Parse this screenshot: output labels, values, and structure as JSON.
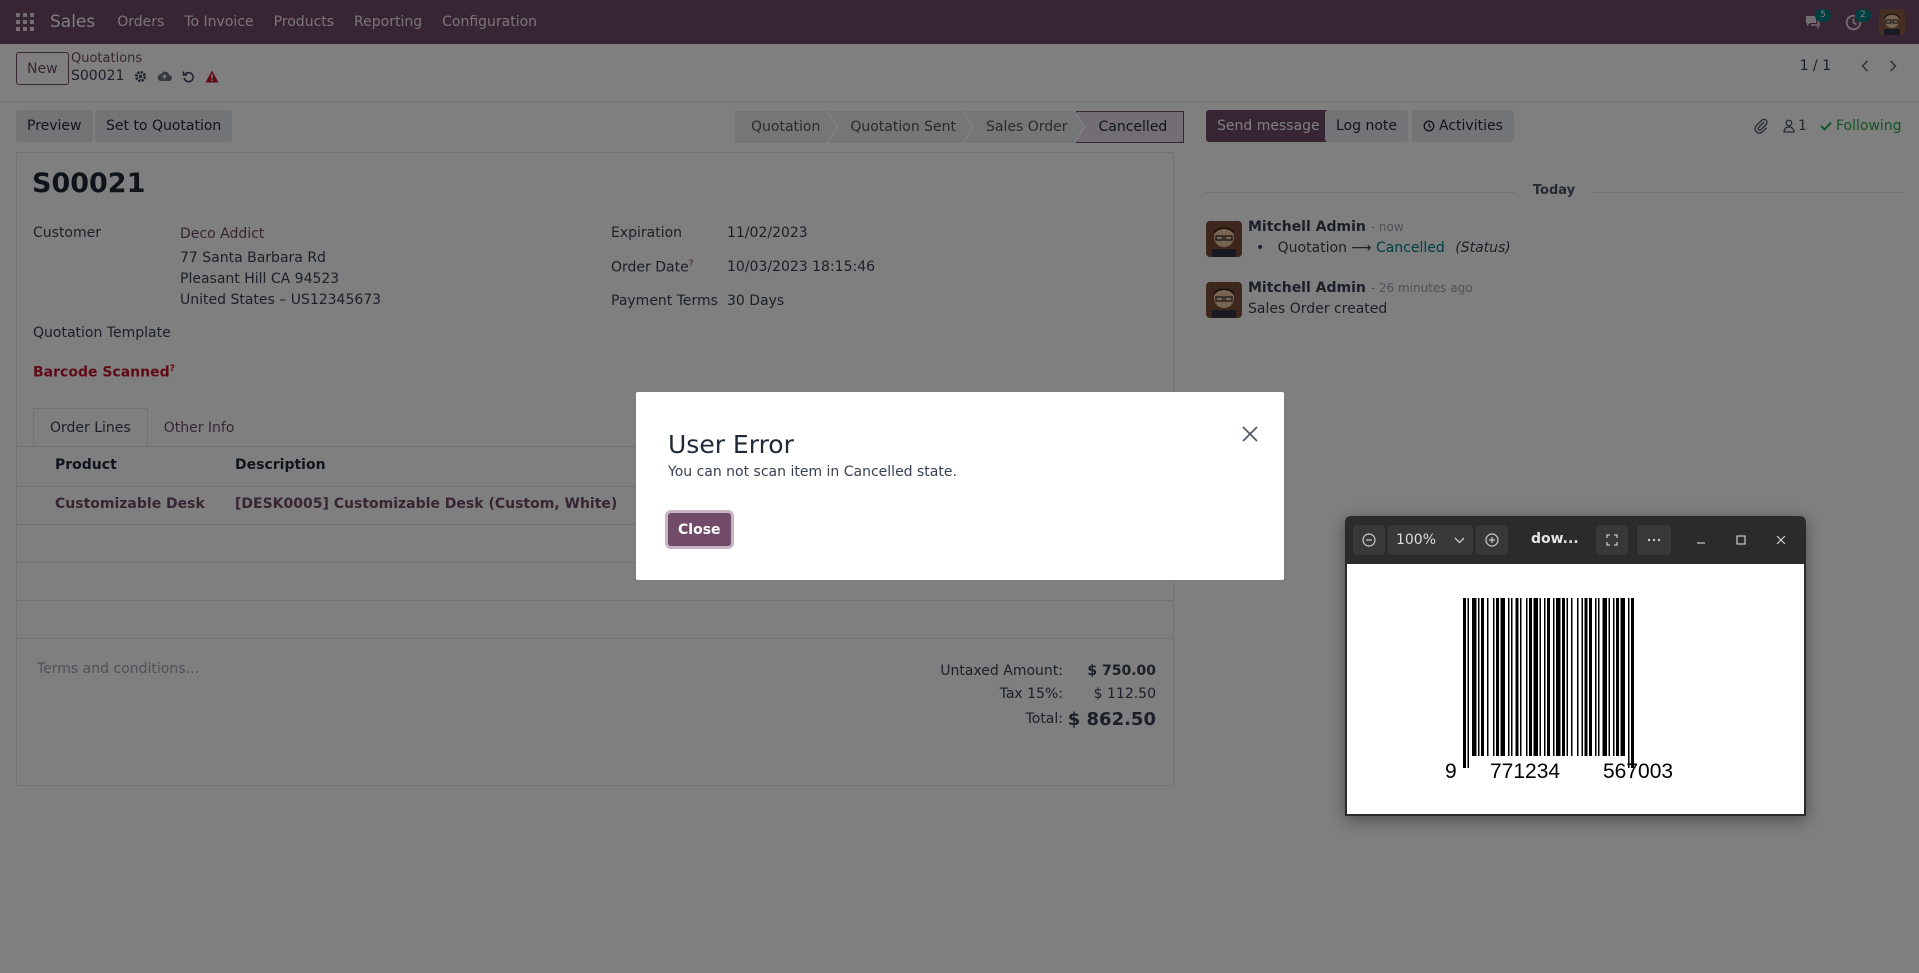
{
  "navbar": {
    "brand": "Sales",
    "menu": [
      "Orders",
      "To Invoice",
      "Products",
      "Reporting",
      "Configuration"
    ],
    "messages_count": "5",
    "activities_count": "2",
    "color": "#714b67"
  },
  "control_panel": {
    "new_label": "New",
    "breadcrumb_parent": "Quotations",
    "breadcrumb_current": "S00021",
    "pager": "1 / 1"
  },
  "actions": {
    "preview": "Preview",
    "set_to_quotation": "Set to Quotation"
  },
  "statusbar": {
    "steps": [
      "Quotation",
      "Quotation Sent",
      "Sales Order",
      "Cancelled"
    ],
    "active": "Cancelled"
  },
  "form": {
    "name": "S00021",
    "customer_label": "Customer",
    "customer_name": "Deco Addict",
    "address_line1": "77 Santa Barbara Rd",
    "address_line2": "Pleasant Hill CA 94523",
    "address_line3": "United States – US12345673",
    "expiration_label": "Expiration",
    "expiration": "11/02/2023",
    "order_date_label": "Order Date",
    "order_date": "10/03/2023 18:15:46",
    "payment_terms_label": "Payment Terms",
    "payment_terms": "30 Days",
    "quotation_template_label": "Quotation Template",
    "barcode_label": "Barcode Scanned",
    "help_mark": "?",
    "tabs": [
      "Order Lines",
      "Other Info"
    ],
    "columns": [
      "Product",
      "Description"
    ],
    "line_product": "Customizable Desk",
    "line_description": "[DESK0005] Customizable Desk (Custom, White)",
    "terms_placeholder": "Terms and conditions...",
    "untaxed_label": "Untaxed Amount:",
    "untaxed": "$ 750.00",
    "tax_label": "Tax 15%:",
    "tax": "$ 112.50",
    "total_label": "Total:",
    "total": "$ 862.50"
  },
  "chatter": {
    "send_message": "Send message",
    "log_note": "Log note",
    "activities": "Activities",
    "followers_count": "1",
    "following": "Following",
    "today": "Today",
    "messages": [
      {
        "author": "Mitchell Admin",
        "time": "- now",
        "from": "Quotation",
        "to": "Cancelled",
        "field": "(Status)"
      },
      {
        "author": "Mitchell Admin",
        "time": "- 26 minutes ago",
        "body": "Sales Order created"
      }
    ]
  },
  "dialog": {
    "title": "User Error",
    "message": "You can not scan item in Cancelled state.",
    "close_label": "Close"
  },
  "viewer": {
    "zoom": "100%",
    "title": "dow...",
    "barcode_digits": [
      "9",
      "771234",
      "567003"
    ]
  }
}
